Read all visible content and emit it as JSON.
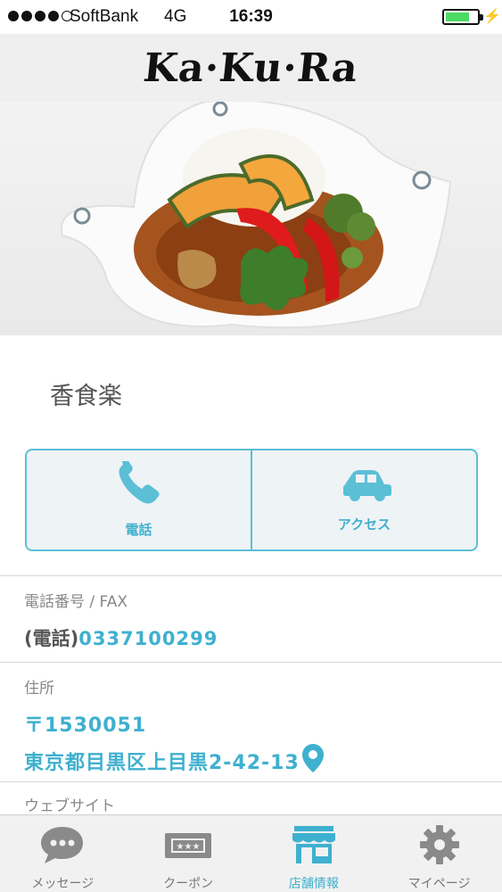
{
  "status_bar": {
    "carrier": "SoftBank",
    "network": "4G",
    "time": "16:39"
  },
  "header": {
    "logo_text": "Ka·Ku·Ra"
  },
  "shop": {
    "name": "香食楽"
  },
  "actions": [
    {
      "label": "電話",
      "icon": "phone-icon"
    },
    {
      "label": "アクセス",
      "icon": "car-icon"
    }
  ],
  "phone_section": {
    "label": "電話番号 / FAX",
    "prefix": "(電話)",
    "number": "0337100299"
  },
  "address_section": {
    "label": "住所",
    "postal_code": "〒1530051",
    "address": "東京都目黒区上目黒2-42-13"
  },
  "website_section": {
    "label": "ウェブサイト"
  },
  "tab_bar": [
    {
      "label": "メッセージ",
      "icon": "chat-bubble-icon",
      "active": false
    },
    {
      "label": "クーポン",
      "icon": "ticket-icon",
      "active": false
    },
    {
      "label": "店舗情報",
      "icon": "storefront-icon",
      "active": true
    },
    {
      "label": "マイページ",
      "icon": "gear-icon",
      "active": false
    }
  ],
  "colors": {
    "accent": "#3fb0cf",
    "border": "#5bbfd6",
    "battery": "#4cd964"
  }
}
